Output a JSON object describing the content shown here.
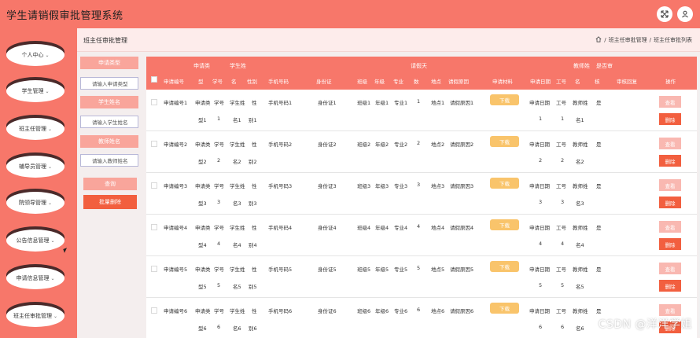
{
  "header": {
    "title": "学生请销假审批管理系统",
    "icons": [
      "expand-icon",
      "user-icon"
    ]
  },
  "sidebar": {
    "items": [
      {
        "label": "个人中心"
      },
      {
        "label": "学生管理"
      },
      {
        "label": "班主任管理"
      },
      {
        "label": "辅导员管理"
      },
      {
        "label": "院领导管理"
      },
      {
        "label": "公告信息管理"
      },
      {
        "label": "申请信息管理"
      },
      {
        "label": "班主任审批管理"
      }
    ]
  },
  "page": {
    "title": "班主任审批管理",
    "breadcrumb": [
      "班主任审批管理",
      "班主任审批列表"
    ]
  },
  "search": {
    "label1": "申请类型",
    "placeholder1": "请输入申请类型",
    "label2": "学生姓名",
    "placeholder2": "请输入学生姓名",
    "label3": "教师姓名",
    "placeholder3": "请输入教师姓名",
    "query_btn": "查询",
    "batch_delete_btn": "批量删除"
  },
  "table": {
    "group_headers": {
      "apply_type": "申请类",
      "student": "学生姓",
      "leave_days": "请假天",
      "teacher": "教师姓",
      "result": "是否审"
    },
    "headers": {
      "apply_no": "申请编号",
      "type": "型",
      "student_no": "学号",
      "name": "名",
      "gender": "性别",
      "phone": "手机号码",
      "id_card": "身份证",
      "class": "班级",
      "grade": "年级",
      "major": "专业",
      "days": "数",
      "location": "地点",
      "reason": "请假原因",
      "material": "申请材料",
      "apply_date": "申请日期",
      "work_no": "工号",
      "t_name": "名",
      "approved": "核",
      "reply": "审核回复",
      "ops": "操作"
    },
    "download_label": "下载",
    "view_label": "查看",
    "delete_label": "删除",
    "rows": [
      {
        "apply_no": "申请编号1",
        "type_a": "申请类",
        "type_b": "型1",
        "student_no_a": "学号",
        "student_no_b": "1",
        "name_a": "学生姓",
        "name_b": "名1",
        "gender_a": "性",
        "gender_b": "别1",
        "phone": "手机号码1",
        "id_card": "身份证1",
        "class": "班级1",
        "grade": "年级1",
        "major": "专业1",
        "days": "1",
        "location": "地点1",
        "reason": "请假原因1",
        "apply_date_a": "申请日期",
        "apply_date_b": "1",
        "work_no_a": "工号",
        "work_no_b": "1",
        "t_name_a": "教师姓",
        "t_name_b": "名1",
        "approved": "是"
      },
      {
        "apply_no": "申请编号2",
        "type_a": "申请类",
        "type_b": "型2",
        "student_no_a": "学号",
        "student_no_b": "2",
        "name_a": "学生姓",
        "name_b": "名2",
        "gender_a": "性",
        "gender_b": "别2",
        "phone": "手机号码2",
        "id_card": "身份证2",
        "class": "班级2",
        "grade": "年级2",
        "major": "专业2",
        "days": "2",
        "location": "地点2",
        "reason": "请假原因2",
        "apply_date_a": "申请日期",
        "apply_date_b": "2",
        "work_no_a": "工号",
        "work_no_b": "2",
        "t_name_a": "教师姓",
        "t_name_b": "名2",
        "approved": "是"
      },
      {
        "apply_no": "申请编号3",
        "type_a": "申请类",
        "type_b": "型3",
        "student_no_a": "学号",
        "student_no_b": "3",
        "name_a": "学生姓",
        "name_b": "名3",
        "gender_a": "性",
        "gender_b": "别3",
        "phone": "手机号码3",
        "id_card": "身份证3",
        "class": "班级3",
        "grade": "年级3",
        "major": "专业3",
        "days": "3",
        "location": "地点3",
        "reason": "请假原因3",
        "apply_date_a": "申请日期",
        "apply_date_b": "3",
        "work_no_a": "工号",
        "work_no_b": "3",
        "t_name_a": "教师姓",
        "t_name_b": "名3",
        "approved": "是"
      },
      {
        "apply_no": "申请编号4",
        "type_a": "申请类",
        "type_b": "型4",
        "student_no_a": "学号",
        "student_no_b": "4",
        "name_a": "学生姓",
        "name_b": "名4",
        "gender_a": "性",
        "gender_b": "别4",
        "phone": "手机号码4",
        "id_card": "身份证4",
        "class": "班级4",
        "grade": "年级4",
        "major": "专业4",
        "days": "4",
        "location": "地点4",
        "reason": "请假原因4",
        "apply_date_a": "申请日期",
        "apply_date_b": "4",
        "work_no_a": "工号",
        "work_no_b": "4",
        "t_name_a": "教师姓",
        "t_name_b": "名4",
        "approved": "是"
      },
      {
        "apply_no": "申请编号5",
        "type_a": "申请类",
        "type_b": "型5",
        "student_no_a": "学号",
        "student_no_b": "5",
        "name_a": "学生姓",
        "name_b": "名5",
        "gender_a": "性",
        "gender_b": "别5",
        "phone": "手机号码5",
        "id_card": "身份证5",
        "class": "班级5",
        "grade": "年级5",
        "major": "专业5",
        "days": "5",
        "location": "地点5",
        "reason": "请假原因5",
        "apply_date_a": "申请日期",
        "apply_date_b": "5",
        "work_no_a": "工号",
        "work_no_b": "5",
        "t_name_a": "教师姓",
        "t_name_b": "名5",
        "approved": "是"
      },
      {
        "apply_no": "申请编号6",
        "type_a": "申请类",
        "type_b": "型6",
        "student_no_a": "学号",
        "student_no_b": "6",
        "name_a": "学生姓",
        "name_b": "名6",
        "gender_a": "性",
        "gender_b": "别6",
        "phone": "手机号码6",
        "id_card": "身份证6",
        "class": "班级6",
        "grade": "年级6",
        "major": "专业6",
        "days": "6",
        "location": "地点6",
        "reason": "请假原因6",
        "apply_date_a": "申请日期",
        "apply_date_b": "6",
        "work_no_a": "工号",
        "work_no_b": "6",
        "t_name_a": "教师姓",
        "t_name_b": "名6",
        "approved": "是"
      }
    ]
  },
  "watermark": "CSDN @洋洋学姐",
  "colors": {
    "primary": "#f7776a",
    "light": "#f9a59b",
    "danger": "#f25f3f",
    "warning": "#f9c46b"
  }
}
